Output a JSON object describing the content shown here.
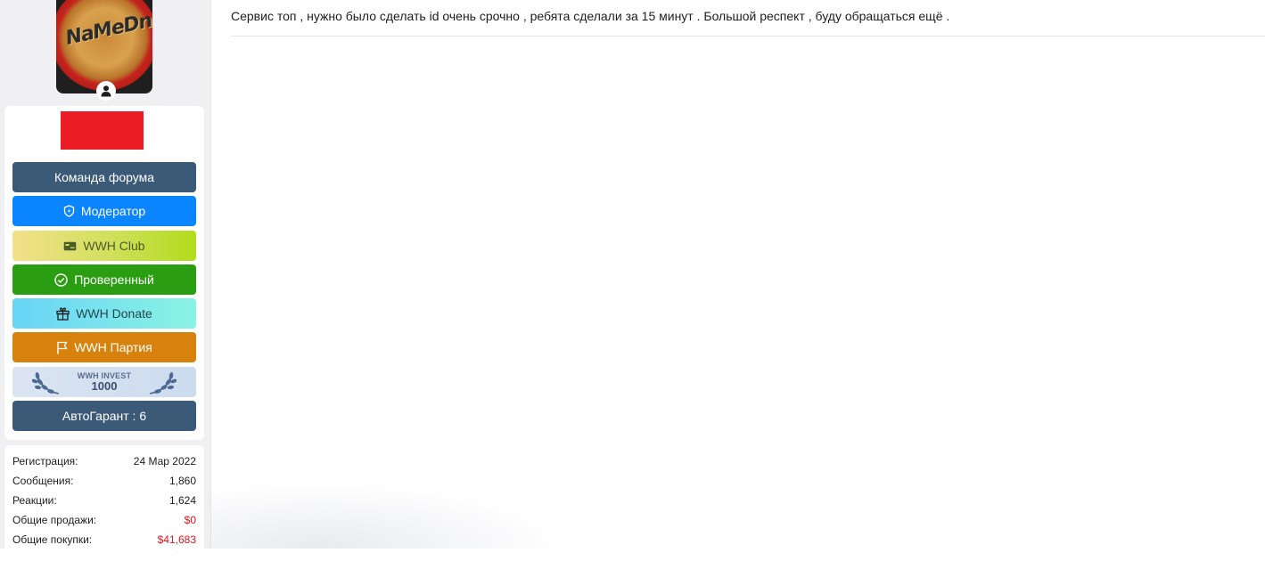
{
  "sidebar": {
    "avatar_text": "NaMeDni",
    "badges": [
      {
        "label": "Команда форума",
        "icon": ""
      },
      {
        "label": "Модератор",
        "icon": "shield-bolt-icon"
      },
      {
        "label": "WWH Club",
        "icon": "card-icon"
      },
      {
        "label": "Проверенный",
        "icon": "check-circle-icon"
      },
      {
        "label": "WWH Donate",
        "icon": "gift-icon"
      },
      {
        "label": "WWH Партия",
        "icon": "flag-icon"
      },
      {
        "label_top": "WWH INVEST",
        "label_bottom": "1000",
        "icon": "laurel-icon"
      },
      {
        "label": "АвтоГарант : 6",
        "icon": ""
      }
    ],
    "stats": [
      {
        "label": "Регистрация:",
        "value": "24 Мар 2022"
      },
      {
        "label": "Сообщения:",
        "value": "1,860"
      },
      {
        "label": "Реакции:",
        "value": "1,624"
      },
      {
        "label": "Общие продажи:",
        "value": "$0"
      },
      {
        "label": "Общие покупки:",
        "value": "$41,683"
      }
    ]
  },
  "post": {
    "text": "Сервис топ , нужно было сделать id очень срочно , ребята сделали за 15 минут . Большой респект , буду обращаться ещё ."
  },
  "colors": {
    "team": "#3a5a78",
    "moderator": "#0a84ff",
    "verified": "#2a9d12",
    "party": "#d7820d",
    "money_red": "#e0141e",
    "flag_red": "#ec1c24"
  }
}
